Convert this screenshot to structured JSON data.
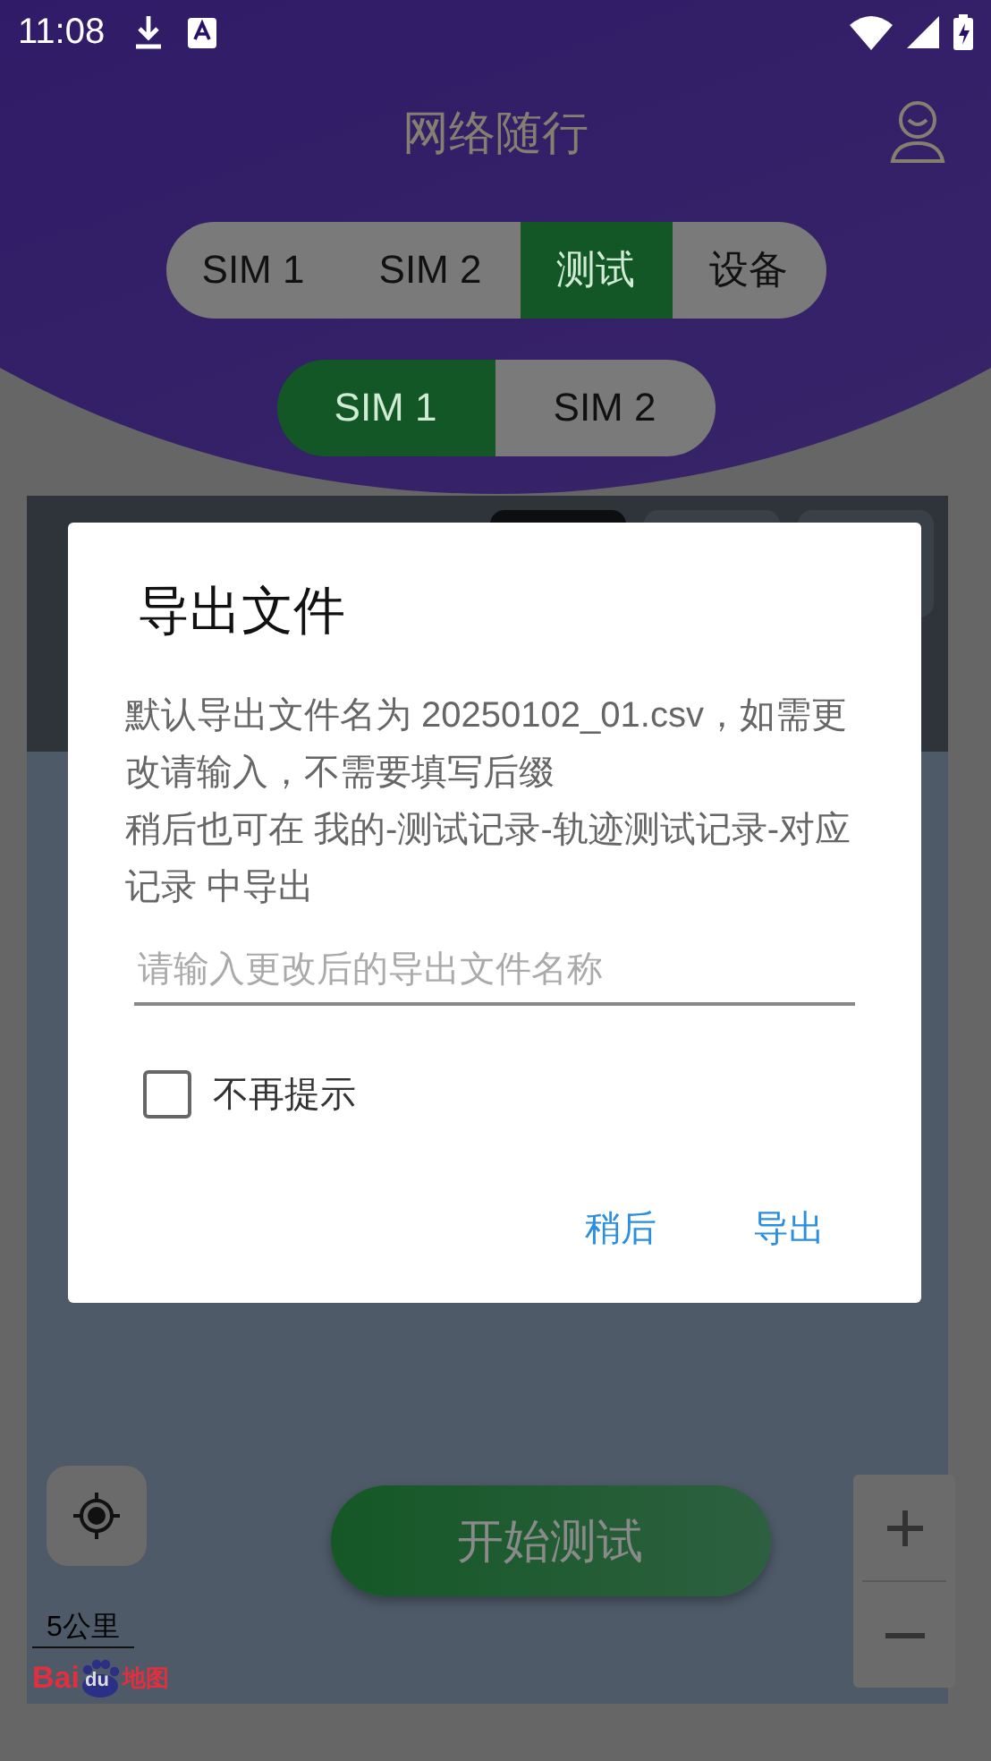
{
  "status_bar": {
    "time": "11:08"
  },
  "header": {
    "title": "网络随行"
  },
  "mode_tabs": [
    {
      "label": "SIM 1",
      "selected": false
    },
    {
      "label": "SIM 2",
      "selected": false
    },
    {
      "label": "测试",
      "selected": true
    },
    {
      "label": "设备",
      "selected": false
    }
  ],
  "sim_tabs": [
    {
      "label": "SIM 1",
      "selected": true
    },
    {
      "label": "SIM 2",
      "selected": false
    }
  ],
  "map": {
    "panel_tabs": [
      {
        "selected": true
      },
      {
        "selected": false
      },
      {
        "selected": false
      }
    ],
    "start_button": "开始测试",
    "scale": "5公里",
    "logo": {
      "left": "Bai",
      "paw": "du",
      "right": "地图"
    }
  },
  "dialog": {
    "title": "导出文件",
    "paragraphs": [
      "默认导出文件名为 20250102_01.csv，如需更改请输入，不需要填写后缀",
      "稍后也可在 我的-测试记录-轨迹测试记录-对应记录 中导出"
    ],
    "input": {
      "placeholder": "请输入更改后的导出文件名称"
    },
    "checkbox": {
      "label": "不再提示",
      "checked": false
    },
    "buttons": [
      "稍后",
      "导出"
    ]
  }
}
